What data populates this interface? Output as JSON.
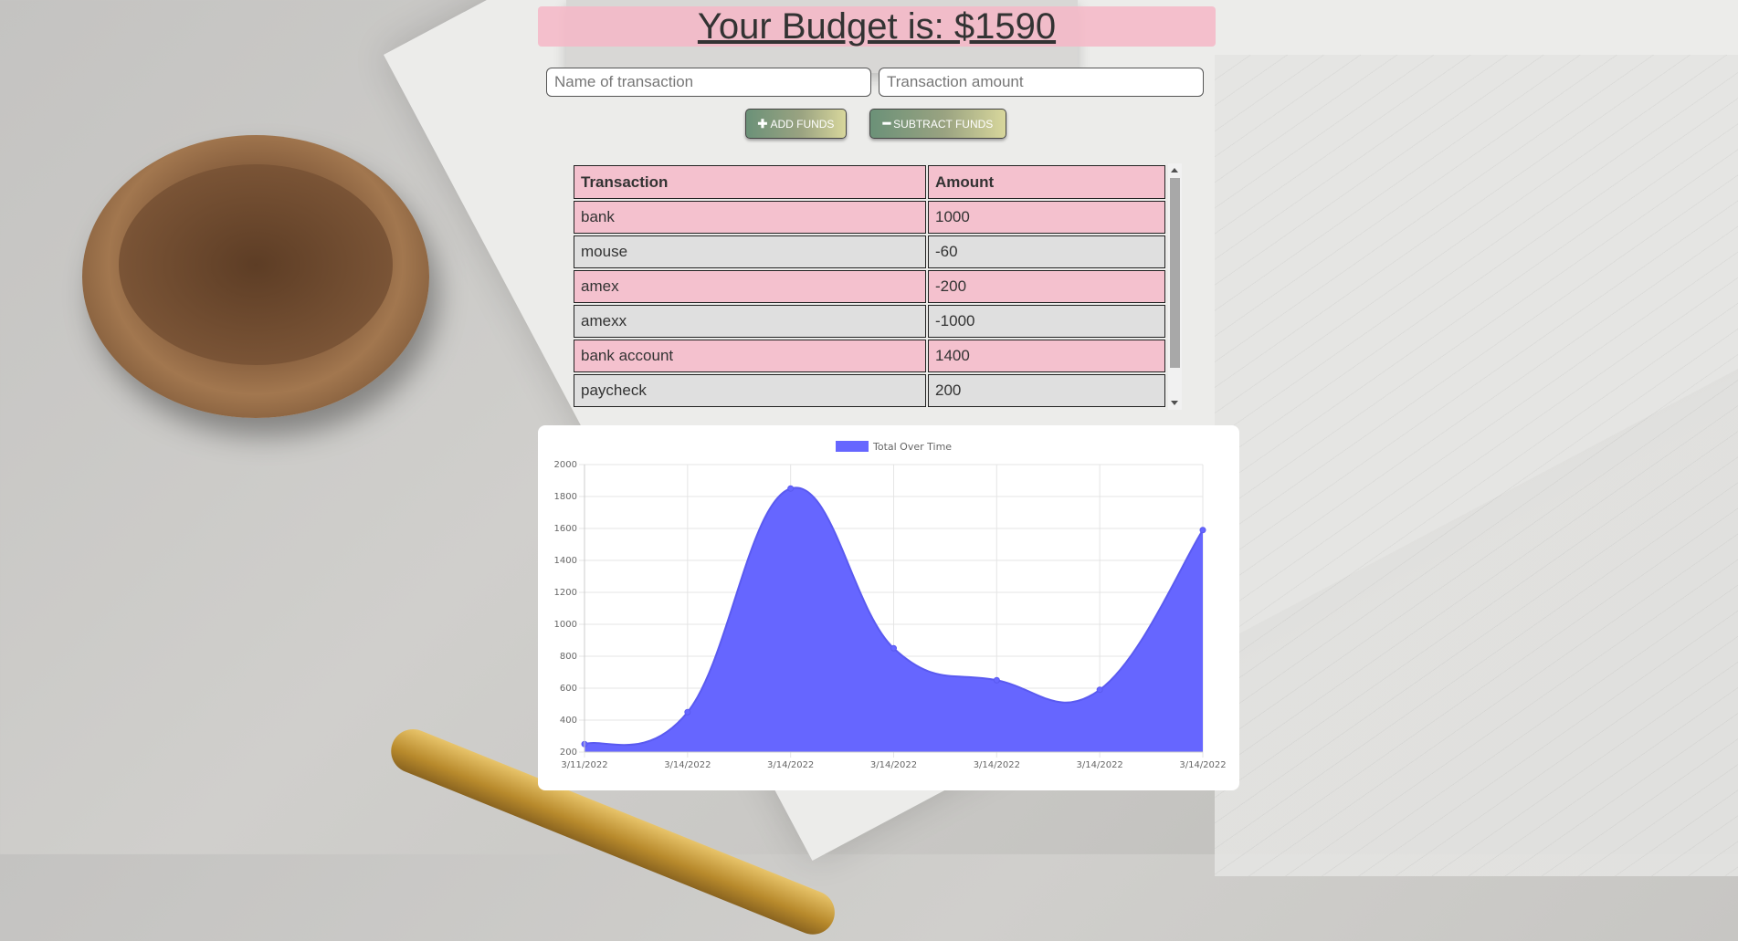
{
  "header": {
    "budget_text": "Your Budget is: $1590"
  },
  "form": {
    "name_placeholder": "Name of transaction",
    "amount_placeholder": "Transaction amount",
    "add_label": "ADD FUNDS",
    "subtract_label": "SUBTRACT FUNDS"
  },
  "table": {
    "headers": [
      "Transaction",
      "Amount"
    ],
    "rows": [
      [
        "bank",
        "1000"
      ],
      [
        "mouse",
        "-60"
      ],
      [
        "amex",
        "-200"
      ],
      [
        "amexx",
        "-1000"
      ],
      [
        "bank account",
        "1400"
      ],
      [
        "paycheck",
        "200"
      ]
    ]
  },
  "colors": {
    "accent_pink": "#f6b7c7",
    "chart_fill": "#6666ff",
    "button_green": "#6b9178"
  },
  "chart_data": {
    "type": "area",
    "legend": [
      "Total Over Time"
    ],
    "legend_position": "top",
    "categories": [
      "3/11/2022",
      "3/14/2022",
      "3/14/2022",
      "3/14/2022",
      "3/14/2022",
      "3/14/2022",
      "3/14/2022"
    ],
    "series": [
      {
        "name": "Total Over Time",
        "values": [
          250,
          450,
          1850,
          850,
          650,
          590,
          1590
        ]
      }
    ],
    "ylim": [
      200,
      2000
    ],
    "yticks": [
      200,
      400,
      600,
      800,
      1000,
      1200,
      1400,
      1600,
      1800,
      2000
    ],
    "grid": true,
    "smooth": true
  }
}
